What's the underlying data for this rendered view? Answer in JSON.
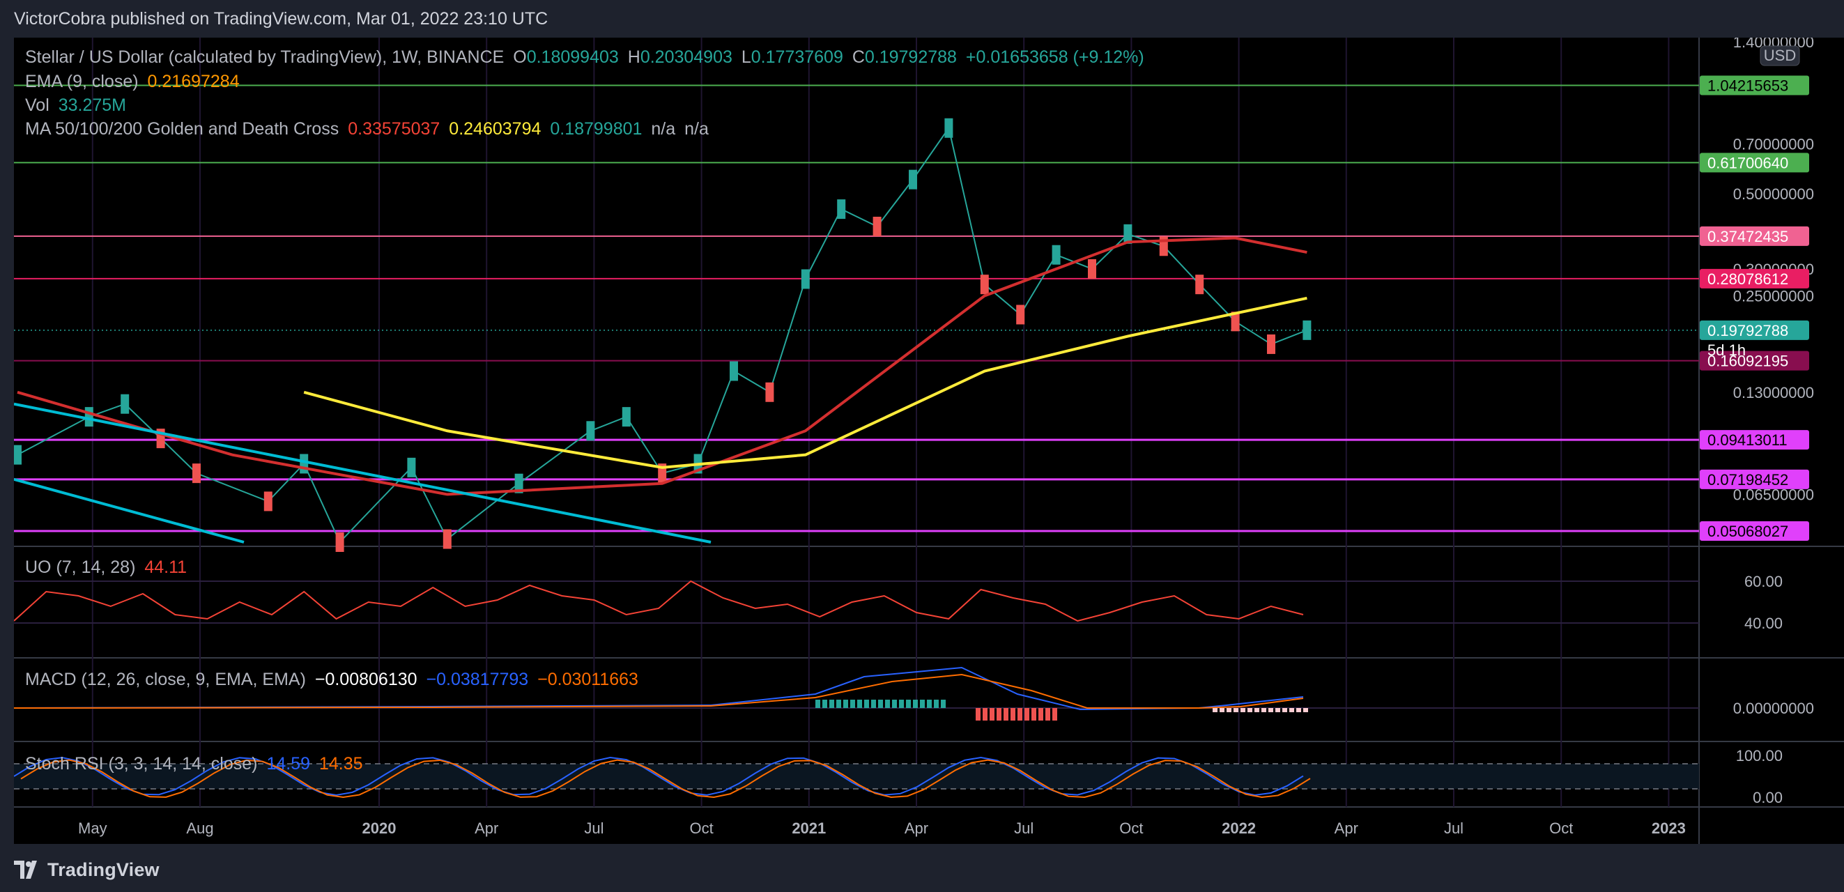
{
  "header": {
    "publisher_line": "VictorCobra published on TradingView.com, Mar 01, 2022 23:10 UTC"
  },
  "legend": {
    "symbol": "Stellar / US Dollar (calculated by TradingView), 1W, BINANCE",
    "o_label": "O",
    "o_value": "0.18099403",
    "h_label": "H",
    "h_value": "0.20304903",
    "l_label": "L",
    "l_value": "0.17737609",
    "c_label": "C",
    "c_value": "0.19792788",
    "change": "+0.01653658 (+9.12%)",
    "ema_label": "EMA (9, close)",
    "ema_value": "0.21697284",
    "vol_label": "Vol",
    "vol_value": "33.275M",
    "ma_label": "MA 50/100/200 Golden and Death Cross",
    "ma50_value": "0.33575037",
    "ma100_value": "0.24603794",
    "ma200_value": "0.18799801",
    "na1": "n/a",
    "na2": "n/a",
    "uo_label": "UO (7, 14, 28)",
    "uo_value": "44.11",
    "macd_label": "MACD (12, 26, close, 9, EMA, EMA)",
    "macd_hist": "−0.00806130",
    "macd_line": "−0.03817793",
    "macd_signal": "−0.03011663",
    "stoch_label": "Stoch RSI (3, 3, 14, 14, close)",
    "stoch_k": "14.59",
    "stoch_d": "14.35"
  },
  "colors": {
    "up": "#26a69a",
    "down": "#ef5350",
    "ema": "#ff9800",
    "ma50": "#d32f2f",
    "ma100": "#ffeb3b",
    "ma200": "#26a69a",
    "uo": "#f44336",
    "macd": "#2962ff",
    "signal": "#ff6d00",
    "trendline": "#00bcd4"
  },
  "footer": {
    "brand": "TradingView"
  },
  "chart_data": {
    "type": "candlestick",
    "title": "Stellar / US Dollar (calculated by TradingView), 1W, BINANCE",
    "y_scale": "log",
    "currency": "USD",
    "ylim": [
      0.047,
      1.4
    ],
    "x_ticks": [
      "May",
      "Aug",
      "2020",
      "Apr",
      "Jul",
      "Oct",
      "2021",
      "Apr",
      "Jul",
      "Oct",
      "2022",
      "Apr",
      "Jul",
      "Oct",
      "2023"
    ],
    "y_ticks": [
      "1.40000000",
      "0.70000000",
      "0.50000000",
      "0.30000000",
      "0.25000000",
      "0.13000000",
      "0.06500000"
    ],
    "price_labels": [
      {
        "value": "1.04215653",
        "color": "#4caf50",
        "text_color": "#000000"
      },
      {
        "value": "0.61700640",
        "color": "#4caf50",
        "text_color": "#ffffff"
      },
      {
        "value": "0.37472435",
        "color": "#f06292",
        "text_color": "#ffffff"
      },
      {
        "value": "0.28078612",
        "color": "#e91e63",
        "text_color": "#ffffff"
      },
      {
        "value": "0.19792788",
        "color": "#26a69a",
        "text_color": "#ffffff"
      },
      {
        "value": "0.16092195",
        "color": "#880e4f",
        "text_color": "#ffffff"
      },
      {
        "value": "0.09413011",
        "color": "#e040fb",
        "text_color": "#000000"
      },
      {
        "value": "0.07198452",
        "color": "#e040fb",
        "text_color": "#000000"
      },
      {
        "value": "0.05068027",
        "color": "#e040fb",
        "text_color": "#000000"
      }
    ],
    "countdown": "5d 1h",
    "last_close": 0.19792788,
    "horizontal_levels": [
      1.04215653,
      0.617,
      0.37472435,
      0.28078612,
      0.16092195,
      0.09413011,
      0.07198452,
      0.05068027
    ],
    "price_series_points": [
      {
        "date": "2019-03",
        "close": 0.085
      },
      {
        "date": "2019-05",
        "close": 0.11
      },
      {
        "date": "2019-06",
        "close": 0.12
      },
      {
        "date": "2019-07",
        "close": 0.095
      },
      {
        "date": "2019-08",
        "close": 0.075
      },
      {
        "date": "2019-10",
        "close": 0.062
      },
      {
        "date": "2019-11",
        "close": 0.08
      },
      {
        "date": "2019-12",
        "close": 0.047
      },
      {
        "date": "2020-02",
        "close": 0.078
      },
      {
        "date": "2020-03",
        "close": 0.048
      },
      {
        "date": "2020-05",
        "close": 0.07
      },
      {
        "date": "2020-07",
        "close": 0.1
      },
      {
        "date": "2020-08",
        "close": 0.11
      },
      {
        "date": "2020-09",
        "close": 0.075
      },
      {
        "date": "2020-10",
        "close": 0.08
      },
      {
        "date": "2020-11",
        "close": 0.15
      },
      {
        "date": "2020-12",
        "close": 0.13
      },
      {
        "date": "2021-01",
        "close": 0.28
      },
      {
        "date": "2021-02",
        "close": 0.45
      },
      {
        "date": "2021-03",
        "close": 0.4
      },
      {
        "date": "2021-04",
        "close": 0.55
      },
      {
        "date": "2021-05",
        "close": 0.78
      },
      {
        "date": "2021-06",
        "close": 0.27
      },
      {
        "date": "2021-07",
        "close": 0.22
      },
      {
        "date": "2021-08",
        "close": 0.33
      },
      {
        "date": "2021-09",
        "close": 0.3
      },
      {
        "date": "2021-10",
        "close": 0.38
      },
      {
        "date": "2021-11",
        "close": 0.35
      },
      {
        "date": "2021-12",
        "close": 0.27
      },
      {
        "date": "2022-01",
        "close": 0.21
      },
      {
        "date": "2022-02",
        "close": 0.18
      },
      {
        "date": "2022-03",
        "close": 0.19792788
      }
    ],
    "ma50_points": [
      {
        "date": "2019-03",
        "value": 0.13
      },
      {
        "date": "2019-09",
        "value": 0.085
      },
      {
        "date": "2020-03",
        "value": 0.065
      },
      {
        "date": "2020-09",
        "value": 0.07
      },
      {
        "date": "2021-01",
        "value": 0.1
      },
      {
        "date": "2021-06",
        "value": 0.25
      },
      {
        "date": "2021-10",
        "value": 0.36
      },
      {
        "date": "2022-01",
        "value": 0.37
      },
      {
        "date": "2022-03",
        "value": 0.33575037
      }
    ],
    "ma100_points": [
      {
        "date": "2019-11",
        "value": 0.13
      },
      {
        "date": "2020-03",
        "value": 0.1
      },
      {
        "date": "2020-09",
        "value": 0.078
      },
      {
        "date": "2021-01",
        "value": 0.085
      },
      {
        "date": "2021-06",
        "value": 0.15
      },
      {
        "date": "2021-10",
        "value": 0.19
      },
      {
        "date": "2022-03",
        "value": 0.24603794
      }
    ],
    "uo": {
      "ylim": [
        30,
        70
      ],
      "ticks": [
        "60.00",
        "40.00"
      ],
      "last": 44.11,
      "values": [
        41,
        55,
        53,
        48,
        54,
        44,
        42,
        50,
        44,
        55,
        42,
        50,
        48,
        57,
        48,
        51,
        58,
        53,
        51,
        44,
        47,
        60,
        52,
        47,
        49,
        43,
        50,
        53,
        45,
        42,
        56,
        52,
        49,
        41,
        45,
        50,
        53,
        44,
        42,
        48,
        44
      ]
    },
    "macd": {
      "ticks": [
        "0.00000000"
      ],
      "macd_last": -0.03817793,
      "signal_last": -0.03011663,
      "hist_last": -0.0080613
    },
    "stoch_rsi": {
      "ylim": [
        0,
        100
      ],
      "ticks": [
        "100.00",
        "0.00"
      ],
      "k_last": 14.59,
      "d_last": 14.35
    }
  }
}
